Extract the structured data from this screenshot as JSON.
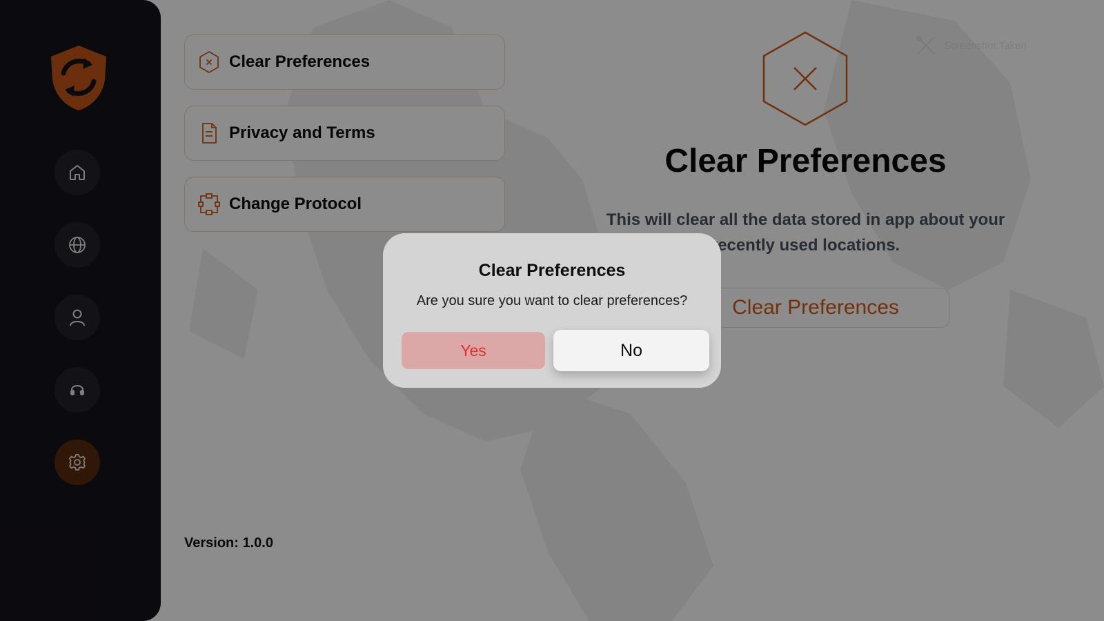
{
  "sidebar": {
    "logo_icon": "shield-refresh-logo",
    "items": [
      {
        "name": "home",
        "icon": "home-icon",
        "active": false
      },
      {
        "name": "locations",
        "icon": "globe-icon",
        "active": false
      },
      {
        "name": "account",
        "icon": "user-icon",
        "active": false
      },
      {
        "name": "support",
        "icon": "headset-icon",
        "active": false
      },
      {
        "name": "settings",
        "icon": "gear-icon",
        "active": true
      }
    ]
  },
  "settings": {
    "items": [
      {
        "label": "Clear Preferences",
        "icon": "hexagon-x-icon"
      },
      {
        "label": "Privacy and Terms",
        "icon": "document-icon"
      },
      {
        "label": "Change Protocol",
        "icon": "protocol-icon"
      }
    ],
    "version": "Version: 1.0.0"
  },
  "detail": {
    "title": "Clear Preferences",
    "description_line1": "This will clear all the data stored in app about your",
    "description_line2": "recently used locations.",
    "button_label": "Clear Preferences",
    "icon": "hexagon-x-icon"
  },
  "toast": {
    "text": "Screenshot Taken",
    "icon": "tools-icon"
  },
  "dialog": {
    "title": "Clear Preferences",
    "message": "Are you sure you want to clear preferences?",
    "yes_label": "Yes",
    "no_label": "No"
  },
  "colors": {
    "accent": "#cc5a14",
    "sidebar_bg": "#15131a",
    "destructive_text": "#e0322b"
  }
}
